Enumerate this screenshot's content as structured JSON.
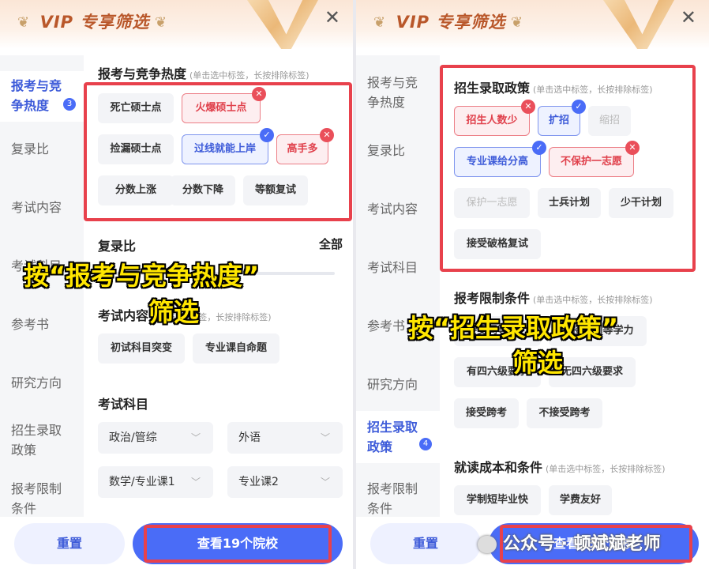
{
  "left": {
    "header": {
      "title": "VIP 专享筛选",
      "close": "✕"
    },
    "sidebar": [
      {
        "label": "报考与竞争热度",
        "count": "3",
        "active": true
      },
      {
        "label": "复录比"
      },
      {
        "label": "考试内容"
      },
      {
        "label": "考试科目"
      },
      {
        "label": "参考书"
      },
      {
        "label": "研究方向"
      },
      {
        "label": "招生录取政策"
      },
      {
        "label": "报考限制条件"
      }
    ],
    "sec1": {
      "title": "报考与竞争热度",
      "hint": "(单击选中标签，长按排除标签)"
    },
    "tags1": [
      "死亡硕士点",
      "火爆硕士点",
      "捡漏硕士点",
      "过线就能上岸",
      "高手多",
      "分数上涨",
      "分数下降",
      "等额复试"
    ],
    "sec2": {
      "title": "复录比",
      "all": "全部"
    },
    "sec3": {
      "title": "考试内容",
      "hint": "(单击选中标签，长按排除标签)"
    },
    "tags3": [
      "初试科目突变",
      "专业课自命题"
    ],
    "sec4": {
      "title": "考试科目"
    },
    "selects": [
      "政治/管综",
      "外语",
      "数学/专业课1",
      "专业课2"
    ],
    "buttons": {
      "reset": "重置",
      "view": "查看19个院校"
    },
    "caption": {
      "line1": "按“报考与竞争热度”",
      "line2": "筛选"
    }
  },
  "right": {
    "header": {
      "title": "VIP 专享筛选",
      "close": "✕"
    },
    "sidebar": [
      {
        "label": "报考与竞争热度"
      },
      {
        "label": "复录比"
      },
      {
        "label": "考试内容"
      },
      {
        "label": "考试科目"
      },
      {
        "label": "参考书"
      },
      {
        "label": "研究方向"
      },
      {
        "label": "招生录取政策",
        "count": "4",
        "active": true
      },
      {
        "label": "报考限制条件"
      }
    ],
    "sec1": {
      "title": "招生录取政策",
      "hint": "(单击选中标签，长按排除标签)"
    },
    "tags1": [
      "招生人数少",
      "扩招",
      "缩招",
      "专业课给分高",
      "不保护一志愿",
      "保护一志愿",
      "士兵计划",
      "少干计划",
      "接受破格复试"
    ],
    "sec2": {
      "title": "报考限制条件",
      "hint": "(单击选中标签，长按排除标签)"
    },
    "tags2": [
      "接受同等学力",
      "不接受同等学力",
      "有四六级要求",
      "无四六级要求",
      "接受跨考",
      "不接受跨考"
    ],
    "sec3": {
      "title": "就读成本和条件",
      "hint": "(单击选中标签，长按排除标签)"
    },
    "tags3": [
      "学制短毕业快",
      "学费友好"
    ],
    "buttons": {
      "reset": "重置",
      "view": "查看13个院校"
    },
    "caption": {
      "line1": "按“招生录取政策”",
      "line2": "筛选"
    }
  },
  "watermark": "公众号 · 顿斌斌老师",
  "colors": {
    "accent": "#4a6cf7",
    "highlight": "#e8414c",
    "caption": "#ffe600",
    "exclude": "#ea4f5a"
  }
}
